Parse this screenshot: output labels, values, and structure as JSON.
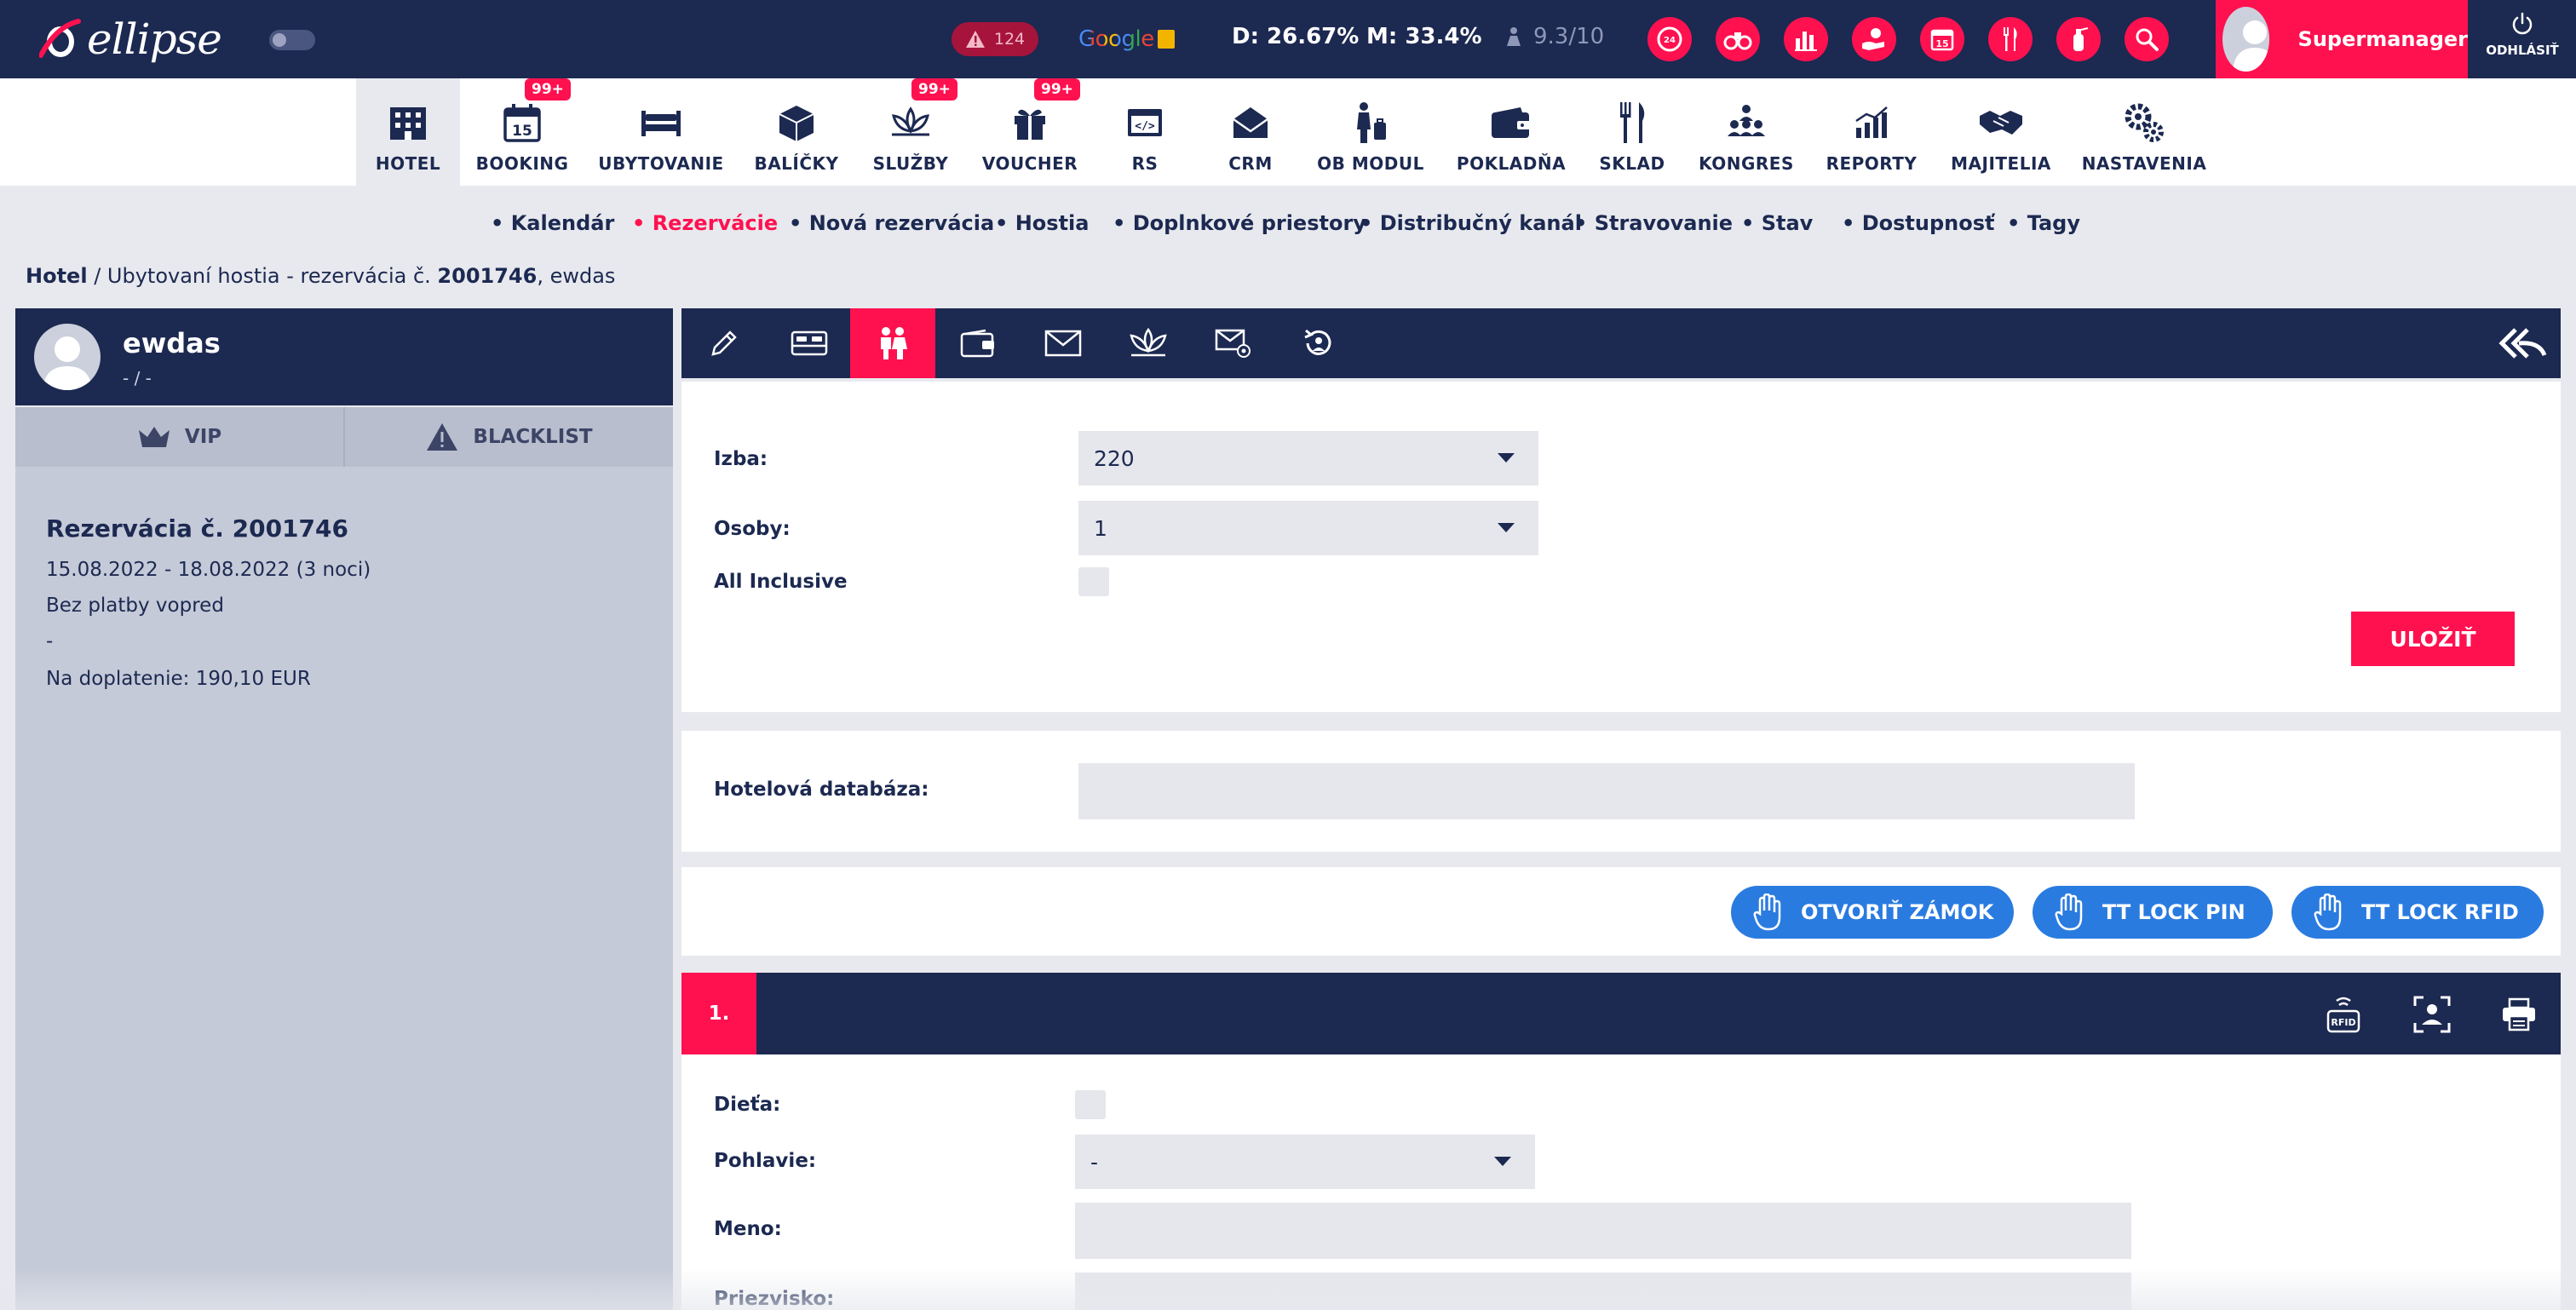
{
  "app": {
    "logo_text": "ellipse",
    "alerts_count": "124",
    "google_label": "Google",
    "occupancy_day": "D: 26.67%",
    "occupancy_month": "M: 33.4%",
    "rating": "9.3/10",
    "user_name": "Supermanager",
    "logout_label": "ODHLÁSIŤ",
    "accent_color": "#ff1150",
    "primary_color": "#1c2951"
  },
  "top_icons": [
    "clock-24-icon",
    "binoculars-icon",
    "bar-chart-icon",
    "hand-coin-icon",
    "calendar-15-icon",
    "cutlery-icon",
    "fire-extinguisher-icon",
    "search-icon"
  ],
  "modules": [
    {
      "label": "HOTEL",
      "icon": "building-icon",
      "badge": ""
    },
    {
      "label": "BOOKING",
      "icon": "calendar-icon",
      "badge": "99+"
    },
    {
      "label": "UBYTOVANIE",
      "icon": "bed-icon",
      "badge": ""
    },
    {
      "label": "BALÍČKY",
      "icon": "package-icon",
      "badge": ""
    },
    {
      "label": "SLUŽBY",
      "icon": "lotus-icon",
      "badge": "99+"
    },
    {
      "label": "VOUCHER",
      "icon": "gift-icon",
      "badge": "99+"
    },
    {
      "label": "RS",
      "icon": "code-window-icon",
      "badge": ""
    },
    {
      "label": "CRM",
      "icon": "envelope-stack-icon",
      "badge": ""
    },
    {
      "label": "OB MODUL",
      "icon": "traveler-icon",
      "badge": ""
    },
    {
      "label": "POKLADŇA",
      "icon": "wallet-icon",
      "badge": ""
    },
    {
      "label": "SKLAD",
      "icon": "fork-knife-icon",
      "badge": ""
    },
    {
      "label": "KONGRES",
      "icon": "audience-icon",
      "badge": ""
    },
    {
      "label": "REPORTY",
      "icon": "growth-chart-icon",
      "badge": ""
    },
    {
      "label": "MAJITELIA",
      "icon": "handshake-icon",
      "badge": ""
    },
    {
      "label": "NASTAVENIA",
      "icon": "gears-icon",
      "badge": ""
    }
  ],
  "submenu": [
    "Kalendár",
    "Rezervácie",
    "Nová rezervácia",
    "Hostia",
    "Doplnkové priestory",
    "Distribučný kanál",
    "Stravovanie",
    "Stav",
    "Dostupnosť",
    "Tagy"
  ],
  "breadcrumb": {
    "root": "Hotel",
    "middle": " / Ubytovaní hostia - rezervácia č. ",
    "number": "2001746",
    "tail": ", ewdas"
  },
  "guest_panel": {
    "name": "ewdas",
    "subtitle": "- / -",
    "vip_label": "VIP",
    "blacklist_label": "BLACKLIST",
    "reservation_title": "Rezervácia č. 2001746",
    "dates": "15.08.2022 - 18.08.2022 (3 noci)",
    "payment": "Bez platby vopred",
    "dash": "-",
    "balance": "Na doplatenie: 190,10 EUR"
  },
  "tabs": [
    "edit-icon",
    "bed-icon",
    "guests-icon",
    "wallet-icon",
    "envelope-icon",
    "lotus-icon",
    "email-at-icon",
    "history-icon"
  ],
  "room_form": {
    "room_label": "Izba:",
    "room_value": "220",
    "persons_label": "Osoby:",
    "persons_value": "1",
    "all_inclusive_label": "All Inclusive",
    "save_label": "ULOŽIŤ"
  },
  "hotel_db": {
    "label": "Hotelová databáza:",
    "value": ""
  },
  "locks": {
    "open_label": "OTVORIŤ ZÁMOK",
    "pin_label": "TT LOCK PIN",
    "rfid_label": "TT LOCK RFID"
  },
  "guest_form": {
    "number": "1.",
    "rfid_label": "RFID",
    "child_label": "Dieťa:",
    "gender_label": "Pohlavie:",
    "gender_value": "-",
    "first_name_label": "Meno:",
    "first_name_value": "",
    "last_name_label": "Priezvisko:",
    "last_name_value": ""
  }
}
